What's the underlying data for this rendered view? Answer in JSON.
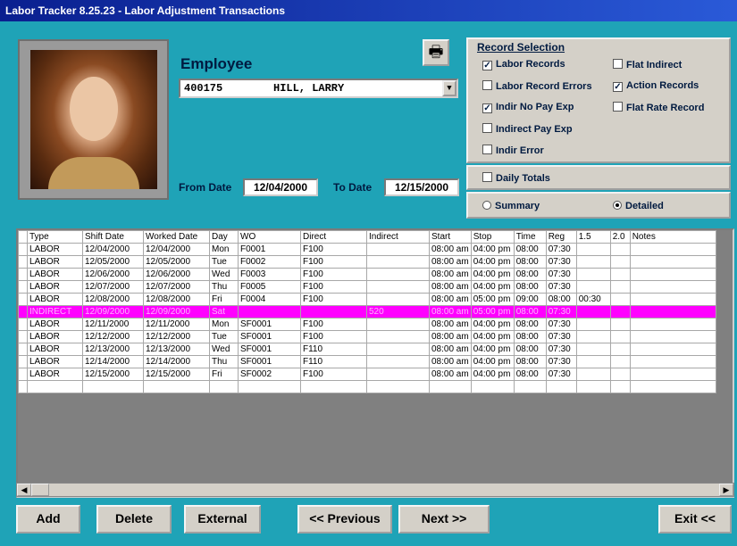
{
  "window": {
    "title": "Labor Tracker 8.25.23 - Labor Adjustment Transactions"
  },
  "employee": {
    "label": "Employee",
    "id": "400175",
    "name": "HILL, LARRY"
  },
  "dates": {
    "from_label": "From Date",
    "from_value": "12/04/2000",
    "to_label": "To Date",
    "to_value": "12/15/2000"
  },
  "record_selection": {
    "title": "Record Selection",
    "options": [
      {
        "label": "Labor Records",
        "checked": true
      },
      {
        "label": "Flat Indirect",
        "checked": false
      },
      {
        "label": "Labor Record Errors",
        "checked": false
      },
      {
        "label": "Action Records",
        "checked": true
      },
      {
        "label": "Indir No Pay Exp",
        "checked": true
      },
      {
        "label": "Flat Rate Record",
        "checked": false
      },
      {
        "label": "Indirect Pay Exp",
        "checked": false
      },
      {
        "label": "Indir Error",
        "checked": false
      }
    ],
    "daily_totals": {
      "label": "Daily Totals",
      "checked": false
    },
    "view": {
      "summary": "Summary",
      "detailed": "Detailed",
      "selected": "Detailed"
    }
  },
  "grid": {
    "columns": [
      "Type",
      "Shift Date",
      "Worked Date",
      "Day",
      "WO",
      "Direct",
      "Indirect",
      "Start",
      "Stop",
      "Time",
      "Reg",
      "1.5",
      "2.0",
      "Notes"
    ],
    "rows": [
      [
        "LABOR",
        "12/04/2000",
        "12/04/2000",
        "Mon",
        "F0001",
        "F100",
        "",
        "08:00 am",
        "04:00 pm",
        "08:00",
        "07:30",
        "",
        "",
        ""
      ],
      [
        "LABOR",
        "12/05/2000",
        "12/05/2000",
        "Tue",
        "F0002",
        "F100",
        "",
        "08:00 am",
        "04:00 pm",
        "08:00",
        "07:30",
        "",
        "",
        ""
      ],
      [
        "LABOR",
        "12/06/2000",
        "12/06/2000",
        "Wed",
        "F0003",
        "F100",
        "",
        "08:00 am",
        "04:00 pm",
        "08:00",
        "07:30",
        "",
        "",
        ""
      ],
      [
        "LABOR",
        "12/07/2000",
        "12/07/2000",
        "Thu",
        "F0005",
        "F100",
        "",
        "08:00 am",
        "04:00 pm",
        "08:00",
        "07:30",
        "",
        "",
        ""
      ],
      [
        "LABOR",
        "12/08/2000",
        "12/08/2000",
        "Fri",
        "F0004",
        "F100",
        "",
        "08:00 am",
        "05:00 pm",
        "09:00",
        "08:00",
        "00:30",
        "",
        ""
      ],
      [
        "INDIRECT",
        "12/09/2000",
        "12/09/2000",
        "Sat",
        "",
        "",
        "520",
        "08:00 am",
        "05:00 pm",
        "08:00",
        "07:30",
        "",
        "",
        ""
      ],
      [
        "LABOR",
        "12/11/2000",
        "12/11/2000",
        "Mon",
        "SF0001",
        "F100",
        "",
        "08:00 am",
        "04:00 pm",
        "08:00",
        "07:30",
        "",
        "",
        ""
      ],
      [
        "LABOR",
        "12/12/2000",
        "12/12/2000",
        "Tue",
        "SF0001",
        "F100",
        "",
        "08:00 am",
        "04:00 pm",
        "08:00",
        "07:30",
        "",
        "",
        ""
      ],
      [
        "LABOR",
        "12/13/2000",
        "12/13/2000",
        "Wed",
        "SF0001",
        "F110",
        "",
        "08:00 am",
        "04:00 pm",
        "08:00",
        "07:30",
        "",
        "",
        ""
      ],
      [
        "LABOR",
        "12/14/2000",
        "12/14/2000",
        "Thu",
        "SF0001",
        "F110",
        "",
        "08:00 am",
        "04:00 pm",
        "08:00",
        "07:30",
        "",
        "",
        ""
      ],
      [
        "LABOR",
        "12/15/2000",
        "12/15/2000",
        "Fri",
        "SF0002",
        "F100",
        "",
        "08:00 am",
        "04:00 pm",
        "08:00",
        "07:30",
        "",
        "",
        ""
      ],
      [
        "",
        "",
        "",
        "",
        "",
        "",
        "",
        "",
        "",
        "",
        "",
        "",
        "",
        ""
      ]
    ],
    "selected_row": 5
  },
  "buttons": {
    "add": "Add",
    "delete": "Delete",
    "external": "External",
    "previous": "<< Previous",
    "next": "Next >>",
    "exit": "Exit <<"
  }
}
